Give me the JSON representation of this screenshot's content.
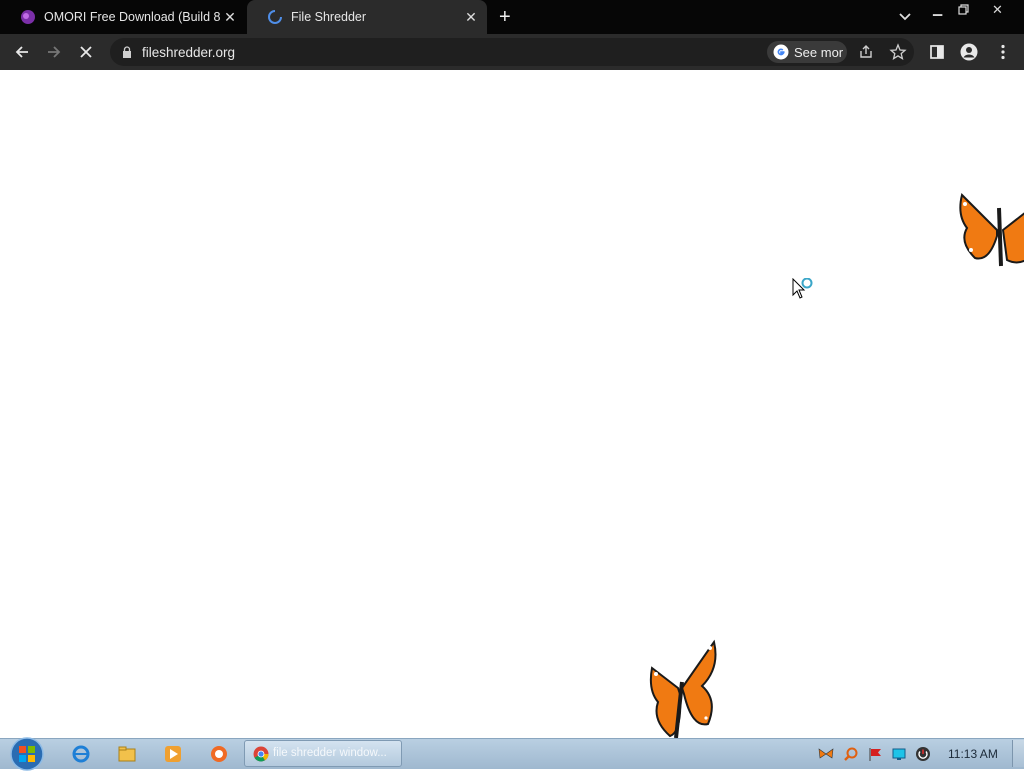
{
  "tabs": [
    {
      "title": "OMORI Free Download (Build 88",
      "icon": "omori-favicon-icon"
    },
    {
      "title": "File Shredder",
      "icon": "loading-spinner-icon"
    }
  ],
  "omnibox": {
    "url": "fileshredder.org",
    "google_chip": "See mor"
  },
  "taskbar": {
    "active_item": "file shredder window...",
    "clock": "11:13 AM"
  },
  "colors": {
    "tab_strip": "#060606",
    "toolbar": "#2b2b2b",
    "butterfly_orange": "#f07a12",
    "taskbar": "#b9cfe2"
  }
}
